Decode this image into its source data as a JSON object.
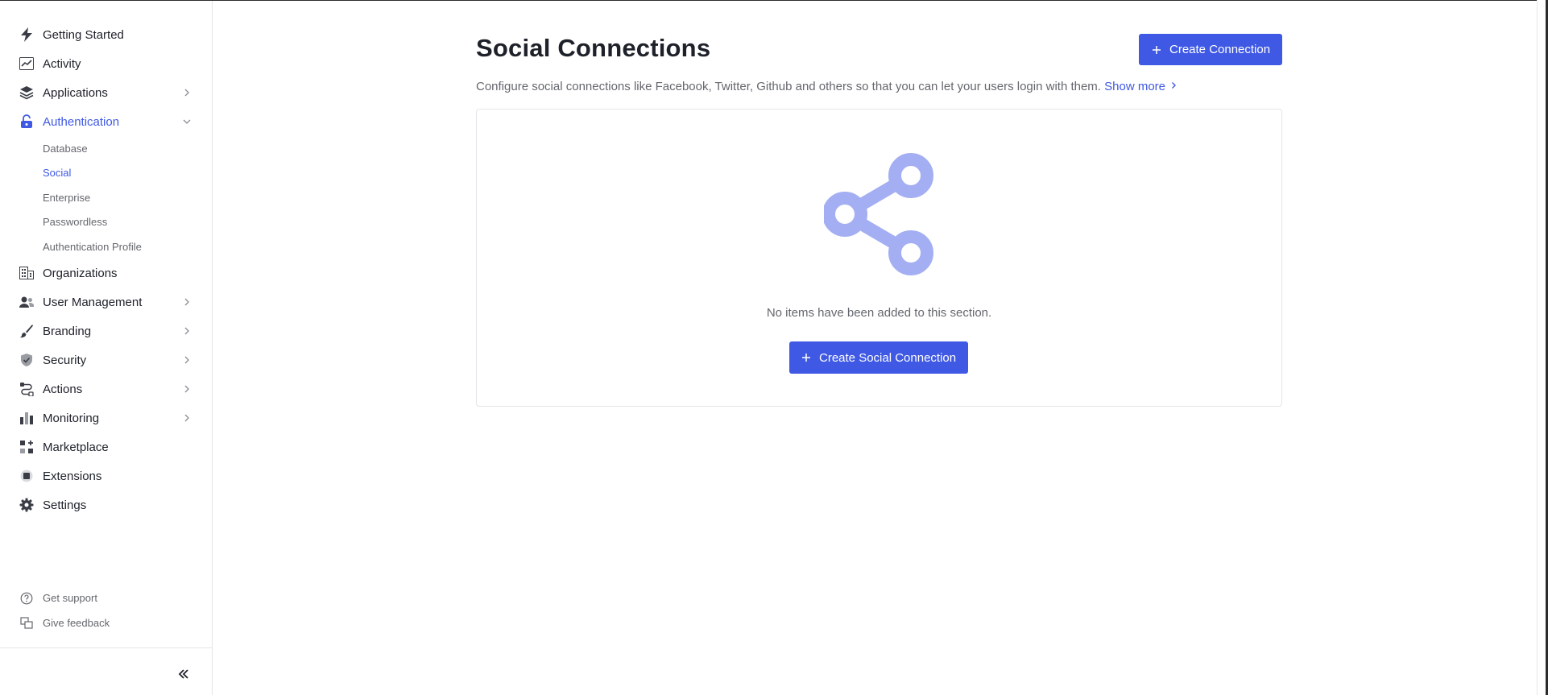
{
  "sidebar": {
    "nav": [
      {
        "label": "Getting Started",
        "icon": "bolt-icon"
      },
      {
        "label": "Activity",
        "icon": "activity-chart-icon"
      },
      {
        "label": "Applications",
        "icon": "layers-icon"
      },
      {
        "label": "Authentication",
        "icon": "lock-icon"
      },
      {
        "label": "Organizations",
        "icon": "building-icon"
      },
      {
        "label": "User Management",
        "icon": "users-icon"
      },
      {
        "label": "Branding",
        "icon": "brush-icon"
      },
      {
        "label": "Security",
        "icon": "shield-check-icon"
      },
      {
        "label": "Actions",
        "icon": "actions-flow-icon"
      },
      {
        "label": "Monitoring",
        "icon": "bar-chart-icon"
      },
      {
        "label": "Marketplace",
        "icon": "marketplace-grid-icon"
      },
      {
        "label": "Extensions",
        "icon": "extensions-chip-icon"
      },
      {
        "label": "Settings",
        "icon": "gear-icon"
      }
    ],
    "auth_subitems": [
      "Database",
      "Social",
      "Enterprise",
      "Passwordless",
      "Authentication Profile"
    ],
    "active_item": "Authentication",
    "active_subitem": "Social",
    "footer": [
      {
        "label": "Get support",
        "icon": "help-circle-icon"
      },
      {
        "label": "Give feedback",
        "icon": "feedback-icon"
      }
    ]
  },
  "main": {
    "title": "Social Connections",
    "create_button": "Create Connection",
    "description": "Configure social connections like Facebook, Twitter, Github and others so that you can let your users login with them.",
    "show_more": "Show more",
    "empty_state": {
      "icon": "share-icon",
      "message": "No items have been added to this section.",
      "button": "Create Social Connection"
    }
  },
  "colors": {
    "accent": "#3f59e4",
    "empty_icon": "#a3aff2",
    "text": "#1e212a",
    "muted": "#65676e"
  }
}
